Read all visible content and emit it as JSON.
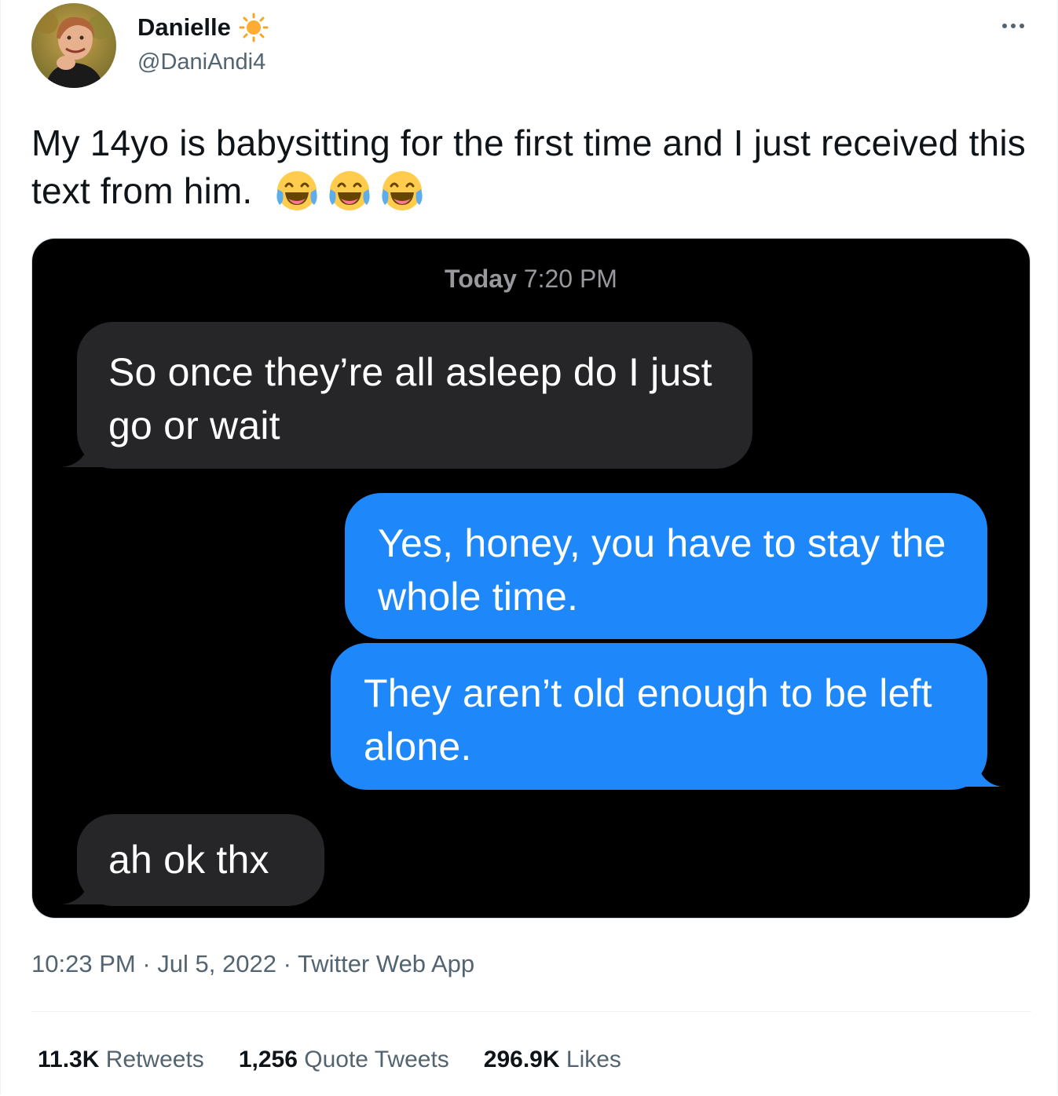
{
  "author": {
    "name": "Danielle",
    "handle": "@DaniAndi4",
    "name_emoji": "sun-icon"
  },
  "tweet": {
    "text": "My 14yo is babysitting for the first time and I just received this text from him.",
    "emojis": [
      "face-with-tears-of-joy-icon",
      "face-with-tears-of-joy-icon",
      "face-with-tears-of-joy-icon"
    ]
  },
  "screenshot": {
    "timestamp_day": "Today",
    "timestamp_time": "7:20 PM",
    "messages": [
      {
        "from": "received",
        "text": "So once they’re all asleep do I just go or wait"
      },
      {
        "from": "sent",
        "text": "Yes, honey, you have to stay the whole time."
      },
      {
        "from": "sent",
        "text": "They aren’t old enough to be left alone."
      },
      {
        "from": "received",
        "text": "ah ok thx"
      }
    ]
  },
  "meta": {
    "time": "10:23 PM",
    "separator": "·",
    "date": "Jul 5, 2022",
    "source": "Twitter Web App"
  },
  "stats": {
    "retweets_count": "11.3K",
    "retweets_label": "Retweets",
    "quotes_count": "1,256",
    "quotes_label": "Quote Tweets",
    "likes_count": "296.9K",
    "likes_label": "Likes"
  },
  "colors": {
    "sent_bubble": "#1e88fa",
    "received_bubble": "#262629",
    "secondary_text": "#536471"
  }
}
